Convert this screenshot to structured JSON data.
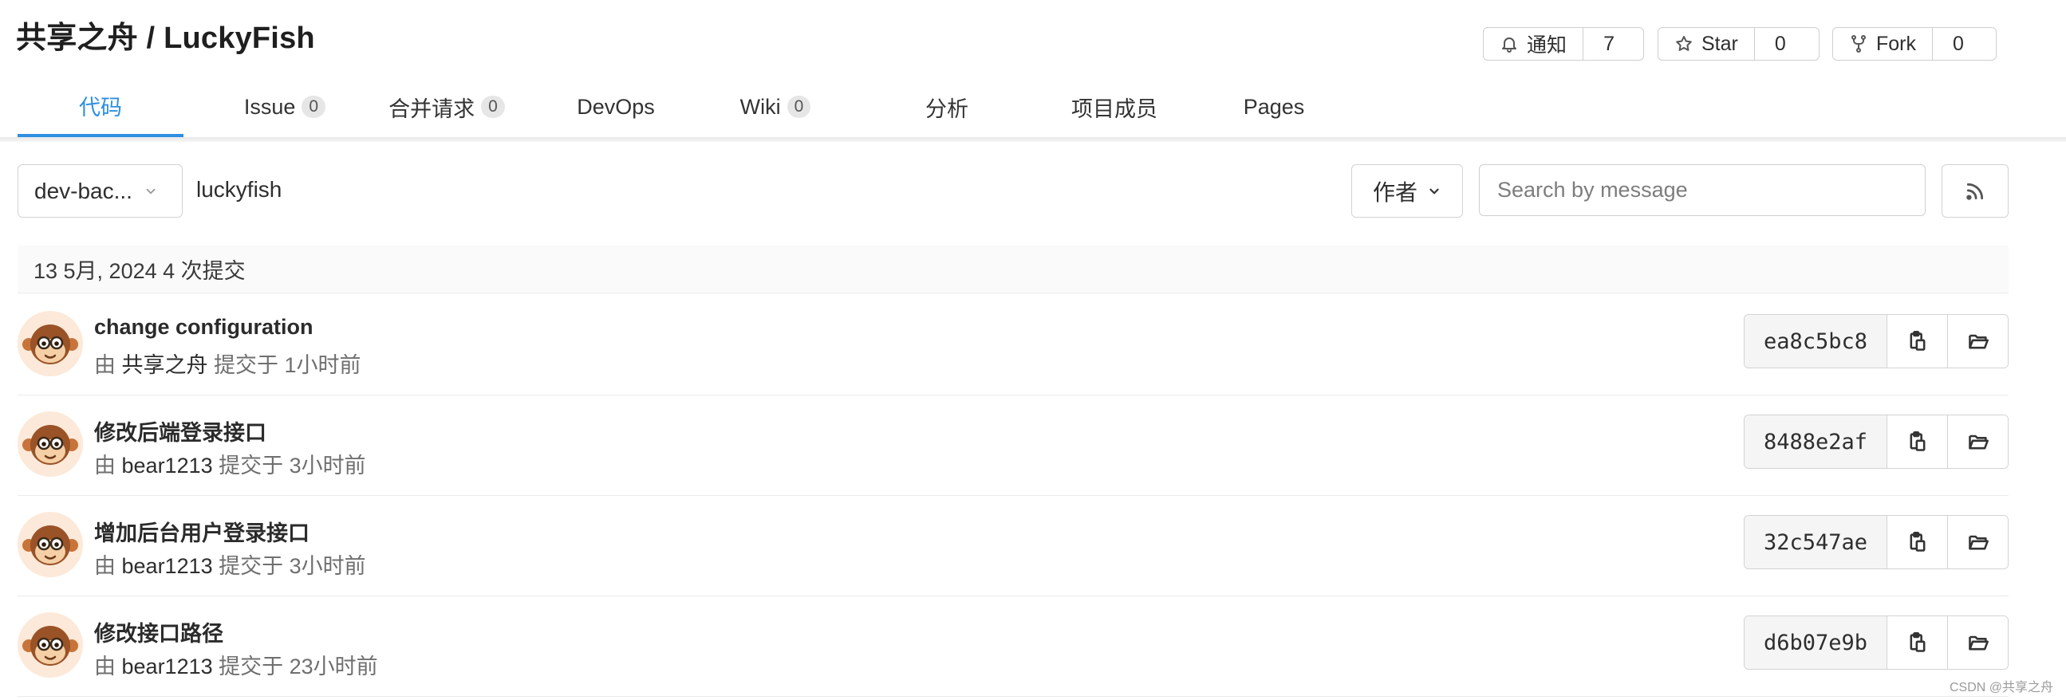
{
  "repo": {
    "title": "共享之舟 / LuckyFish"
  },
  "actions": {
    "notify": {
      "label": "通知",
      "count": "7",
      "icon": "bell-icon"
    },
    "star": {
      "label": "Star",
      "count": "0",
      "icon": "star-icon"
    },
    "fork": {
      "label": "Fork",
      "count": "0",
      "icon": "fork-icon"
    }
  },
  "tabs": [
    {
      "label": "代码",
      "active": true
    },
    {
      "label": "Issue",
      "badge": "0"
    },
    {
      "label": "合并请求",
      "badge": "0"
    },
    {
      "label": "DevOps"
    },
    {
      "label": "Wiki",
      "badge": "0"
    },
    {
      "label": "分析"
    },
    {
      "label": "项目成员"
    },
    {
      "label": "Pages"
    }
  ],
  "filters": {
    "branch": "dev-bac...",
    "path": "luckyfish",
    "author_label": "作者",
    "search_placeholder": "Search by message"
  },
  "day_header": "13 5月, 2024 4 次提交",
  "commits": [
    {
      "title": "change configuration",
      "by": "由",
      "author": "共享之舟",
      "time": "提交于 1小时前",
      "sha": "ea8c5bc8"
    },
    {
      "title": "修改后端登录接口",
      "by": "由",
      "author": "bear1213",
      "time": "提交于 3小时前",
      "sha": "8488e2af"
    },
    {
      "title": "增加后台用户登录接口",
      "by": "由",
      "author": "bear1213",
      "time": "提交于 3小时前",
      "sha": "32c547ae"
    },
    {
      "title": "修改接口路径",
      "by": "由",
      "author": "bear1213",
      "time": "提交于 23小时前",
      "sha": "d6b07e9b"
    }
  ],
  "colors": {
    "accent": "#2f8fe0",
    "border": "#d3d3d3",
    "muted": "#6f6f6f"
  },
  "watermark": "CSDN @共享之舟"
}
